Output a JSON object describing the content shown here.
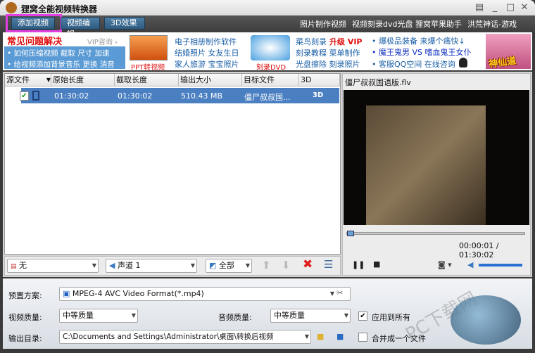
{
  "app": {
    "title": "狸窝全能视频转换器"
  },
  "toolbar": {
    "add_video": "添加视频",
    "edit_video": "视频编辑",
    "effect_3d": "3D效果",
    "links": [
      "照片制作视频",
      "视频刻录dvd光盘",
      "狸窝苹果助手",
      "洪荒神话-游戏"
    ]
  },
  "banner": {
    "faq_title": "常见问题解决",
    "vip": "VIP咨询 ›",
    "faq_line1": "• 如何压缩视频  截取  尺寸  加速",
    "faq_line2": "• 给视频添加背景音乐  更换  消音",
    "ppt": "PPT转视频",
    "album": [
      "电子相册制作软件",
      "结婚照片  女友生日",
      "家人旅游  宝宝照片"
    ],
    "dvd": "刻录DVD",
    "burn": [
      "菜鸟刻录",
      "升级 VIP",
      "刻录教程  菜单制作",
      "光盘擦除  刻录照片"
    ],
    "news": [
      "• 爆极品装备  来爆个痛快↓",
      "• 魔王鬼男 VS 嗜血鬼王女仆",
      "• 客服QQ空间  在线咨询"
    ],
    "game": "神仙道"
  },
  "list": {
    "columns": [
      "源文件",
      "原始长度",
      "截取长度",
      "输出大小",
      "目标文件",
      "3D"
    ],
    "rows": [
      {
        "checked": true,
        "original": "01:30:02",
        "clip": "01:30:02",
        "size": "510.43 MB",
        "target": "僵尸叔叔国...",
        "d3": "3D"
      }
    ]
  },
  "controls": {
    "subtitle": "无",
    "audio": "声道 1",
    "range": "全部"
  },
  "player": {
    "filename": "僵尸叔叔国语版.flv",
    "time": "00:00:01 / 01:30:02",
    "progress": 0.0,
    "volume": 1.0
  },
  "settings": {
    "preset_label": "预置方案:",
    "preset": "MPEG-4 AVC Video Format(*.mp4)",
    "vq_label": "视频质量:",
    "vq": "中等质量",
    "aq_label": "音频质量:",
    "aq": "中等质量",
    "apply_all": "应用到所有",
    "apply_all_checked": true,
    "out_label": "输出目录:",
    "out": "C:\\Documents and Settings\\Administrator\\桌面\\转换后视频",
    "merge": "合并成一个文件",
    "merge_checked": false
  },
  "colors": {
    "highlight": "#e040e0",
    "selection": "#4a7fc1",
    "faq_red": "#e01010"
  }
}
